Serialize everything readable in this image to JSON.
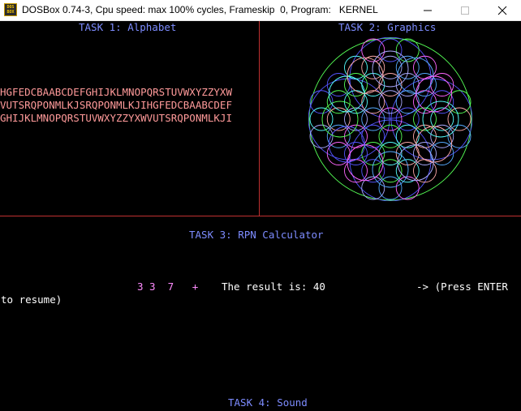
{
  "window": {
    "title": "DOSBox 0.74-3, Cpu speed: max 100% cycles, Frameskip  0, Program:   KERNEL",
    "icon_text_top": "DOS",
    "icon_text_bottom": "BOX",
    "icon": "dosbox-icon",
    "buttons": [
      "minimize-icon",
      "maximize-icon",
      "close-icon"
    ]
  },
  "task1": {
    "title": "TASK 1: Alphabet",
    "lines": [
      "HGFEDCBAABCDEFGHIJKLMNOPQRSTUVWXYZZYXW",
      "VUTSRQPONMLKJSRQPONMLKJIHGFEDCBAABCDEF",
      "GHIJKLMNOPQRSTUVWXYZZYXWVUTSRQPONMLKJI"
    ]
  },
  "task2": {
    "title": "TASK 2: Graphics",
    "colors": [
      "#ff66ff",
      "#5555ff",
      "#55ff55",
      "#55ffff",
      "#ffaaaa",
      "#aaaaff",
      "#55aaff"
    ]
  },
  "task3": {
    "title": "TASK 3: RPN Calculator",
    "input": "3 3  7   +",
    "result_label": "The result is: 40",
    "prompt_line1": "-> (Press ENTER",
    "prompt_line2": "to resume)"
  },
  "task4": {
    "title": "TASK 4: Sound"
  },
  "colors": {
    "task_title": "#7d8cff",
    "alphabet": "#ff9a9a",
    "divider": "#c03030",
    "input_digits": "#ff8cff",
    "text": "#ffffff"
  }
}
